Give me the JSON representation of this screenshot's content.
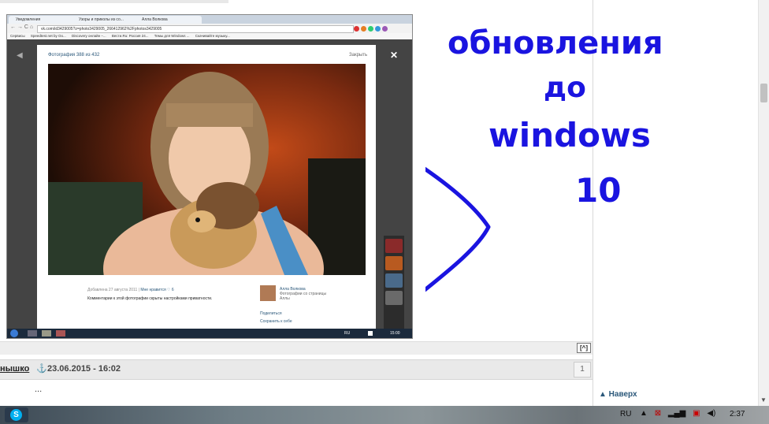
{
  "embedded_screenshot": {
    "tabs": [
      "Уведомления",
      "Узоры и приколы из со...",
      "Алла Волкова"
    ],
    "address_url": "vk.com/id3429005?z=photo3429005_266412962%2Fphotos3429005",
    "bookmarks": [
      "Сервисы",
      "Speedtest.net by Oo...",
      "Discovery онлайн –...",
      "Вести.Ru: Россия 24...",
      "Темы для Windows ...",
      "Скачивайте музыку..."
    ],
    "photo_viewer": {
      "header": "Фотография 388 из 432",
      "close_label": "Закрыть",
      "added": "Добавлена 27 августа 2011",
      "likes": "Мне нравится ♡ 6",
      "comments_note": "Комментарии к этой фотографии скрыты настройками приватности.",
      "owner_name": "Алла Волкова",
      "owner_photos": "Фотографии со страницы Аллы",
      "share": "Поделиться",
      "save": "Сохранить к себе"
    },
    "taskbar": {
      "lang": "RU",
      "time": "15:00"
    }
  },
  "annotation": {
    "lines": [
      "обновления",
      "до",
      "windows",
      "10"
    ],
    "color": "#1a14e0"
  },
  "reply": {
    "button_label": "[^]"
  },
  "post": {
    "author": "нышко",
    "date": "23.06.2015 - 16:02",
    "number": "1",
    "body": "..."
  },
  "back_to_top": "▲ Наверх",
  "os_taskbar": {
    "lang": "RU",
    "time": "2:37",
    "skype_letter": "S"
  }
}
